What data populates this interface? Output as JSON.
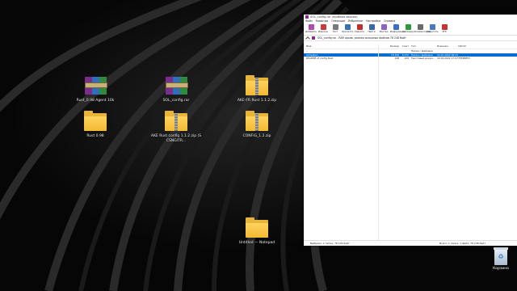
{
  "desktop": {
    "icons": [
      {
        "label": "Rust_0.98 Agent 10k",
        "kind": "rar"
      },
      {
        "label": "SOL_config.rar",
        "kind": "rar"
      },
      {
        "label": "AKE-FR Rust 1.1.2.zip",
        "kind": "zip"
      },
      {
        "label": "Rust 0.98",
        "kind": "folder"
      },
      {
        "label": "AKE Rust config 1.1.2.zip (SCSNGITR...",
        "kind": "zip"
      },
      {
        "label": "CONFIG_1.2.zip",
        "kind": "zip"
      },
      {
        "label": "Untitled — Notepad",
        "kind": "folder"
      }
    ],
    "recycle_bin_label": "Корзина"
  },
  "window": {
    "title": "SOL_config.rar (пробная версия)",
    "menu": [
      "Файл",
      "Команды",
      "Операции",
      "Избранное",
      "Настройки",
      "Справка"
    ],
    "toolbar": [
      {
        "label": "Добавить",
        "icon": "add-icon",
        "color": "#b04ab0"
      },
      {
        "label": "Извлечь",
        "icon": "extract-icon",
        "color": "#c93a3a"
      },
      {
        "label": "Тест",
        "icon": "test-icon",
        "color": "#7a7a7a"
      },
      {
        "label": "Просмотр",
        "icon": "view-icon",
        "color": "#3b6fb5"
      },
      {
        "label": "Удалить",
        "icon": "delete-icon",
        "color": "#c03030"
      },
      {
        "label": "Найти",
        "icon": "find-icon",
        "color": "#3a67a8"
      },
      {
        "label": "Мастер",
        "icon": "wizard-icon",
        "color": "#8a63c7"
      },
      {
        "label": "Информация",
        "icon": "info-icon",
        "color": "#3a71c4"
      },
      {
        "label": "Антивирус",
        "icon": "virus-scan-icon",
        "color": "#2e9a3d"
      },
      {
        "label": "Комментарий",
        "icon": "comment-icon",
        "color": "#6a6a6a"
      },
      {
        "label": "Защитить",
        "icon": "protect-icon",
        "color": "#4a78c4"
      },
      {
        "label": "SFX",
        "icon": "sfx-icon",
        "color": "#c83232"
      }
    ],
    "address": "SOL_config.rar - RAR архив, размер исходных файлов 78 248 байт",
    "columns": [
      "Имя",
      "Размер",
      "Сжат",
      "Тип",
      "Изменён",
      "CRC32"
    ],
    "rows": [
      {
        "name": "..",
        "size": "",
        "packed": "",
        "type": "Папка с файлами",
        "modified": "",
        "crc": ""
      },
      {
        "name": "Activation",
        "size": "78 100",
        "packed": "6 972",
        "type": "Папка с файлами",
        "modified": "22.01.2022 18:13",
        "crc": ""
      },
      {
        "name": "README of config Rust",
        "size": "148",
        "packed": "129",
        "type": "Текстовый докум...",
        "modified": "22.01.2022 17:07",
        "crc": "7E35BE53"
      }
    ],
    "status_left": "Выбрано: 1 папка, 78 100 байт",
    "status_right": "Всего: 1 папка, 1 файл, 78 248 байт"
  }
}
